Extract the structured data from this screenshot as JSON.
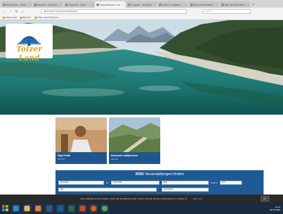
{
  "browser": {
    "tabs": [
      {
        "title": "Bad Wiessee - Wissen für ..."
      },
      {
        "title": "Übersicht - Gästeserv..."
      },
      {
        "title": "Tegernsee - Gäste ..."
      },
      {
        "title": "Veranstaltungen in der Reg...",
        "active": true
      },
      {
        "title": "Lenggries - Veranstalt..."
      },
      {
        "title": "Urlaub in Lenggries ..."
      },
      {
        "title": "Bad Tölz Veranstaltungen ..."
      },
      {
        "title": "Bad Tölz Veranstaltungen ..."
      }
    ],
    "new_tab_label": "+",
    "url": "www.toelzer-land.de/veranstaltungen",
    "search_placeholder": "Suche",
    "nav": {
      "back": "‹",
      "forward": "›",
      "reload": "↻",
      "home": "⌂"
    },
    "bookmarks": [
      "Tölzer Land",
      "Bad Tölz",
      "Tölzer Land Tourismus"
    ]
  },
  "logo": {
    "text": "Tölzer Land"
  },
  "cards": [
    {
      "title": "Pippi Politia",
      "date": "30.06.18"
    },
    {
      "title": "Karwendel Jubiläumstour",
      "date": "30.06.18"
    }
  ],
  "events": {
    "count": "3055",
    "heading_suffix": "Veranstaltungen finden",
    "row1": {
      "field1": "Heute/Alle",
      "label_bis": "bis",
      "date": "30.06.2018",
      "field3": "Bitte...",
      "label_umkreis": "Umkreis",
      "radius": "0 km"
    },
    "row2": {
      "field1": "Alle",
      "field2": "Suchbegriff..."
    }
  },
  "cookie": {
    "text": "Diese Website benutzt Cookies. Wenn Sie die Website weiter nutzen, stimmen Sie der Verwendung von Cookies zu.",
    "more_link": "Mehr Infos",
    "ok_label": "OK"
  },
  "taskbar": {
    "time": "12:40",
    "date": "29.06.2018"
  }
}
